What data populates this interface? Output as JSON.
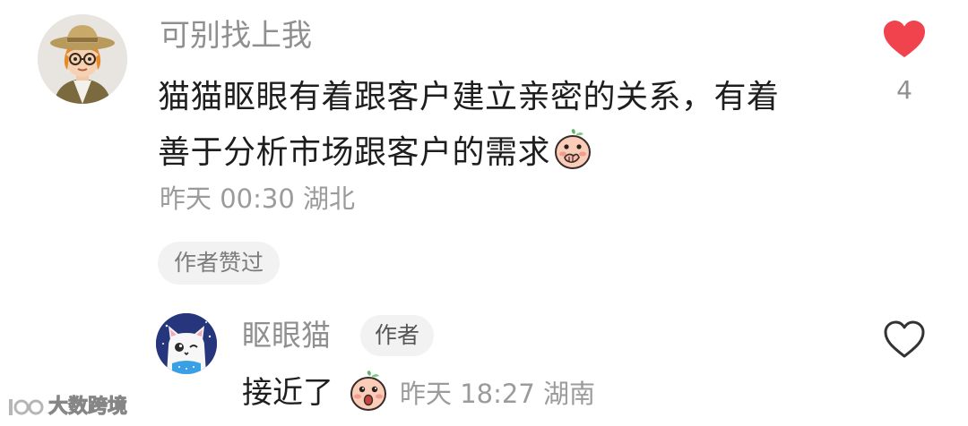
{
  "comment": {
    "username": "可别找上我",
    "text_lines": [
      "猫猫眍眼有着跟客户建立亲密的关系，有着",
      "善于分析市场跟客户的需求"
    ],
    "time": "昨天 00:30",
    "location": "湖北",
    "author_liked_label": "作者赞过",
    "like_count": "4",
    "liked": true,
    "like_color": "#f0434e",
    "avatar_icon": "avatar-cowboy-hat-glasses",
    "emoji_icon": "peach-covering-mouth-emoji"
  },
  "reply": {
    "username": "眍眼猫",
    "author_badge": "作者",
    "text": "接近了",
    "emoji_icon": "peach-surprised-emoji",
    "time": "昨天 18:27",
    "location": "湖南",
    "avatar_icon": "avatar-white-cat-winking"
  },
  "watermark": {
    "text": "大数跨境"
  }
}
